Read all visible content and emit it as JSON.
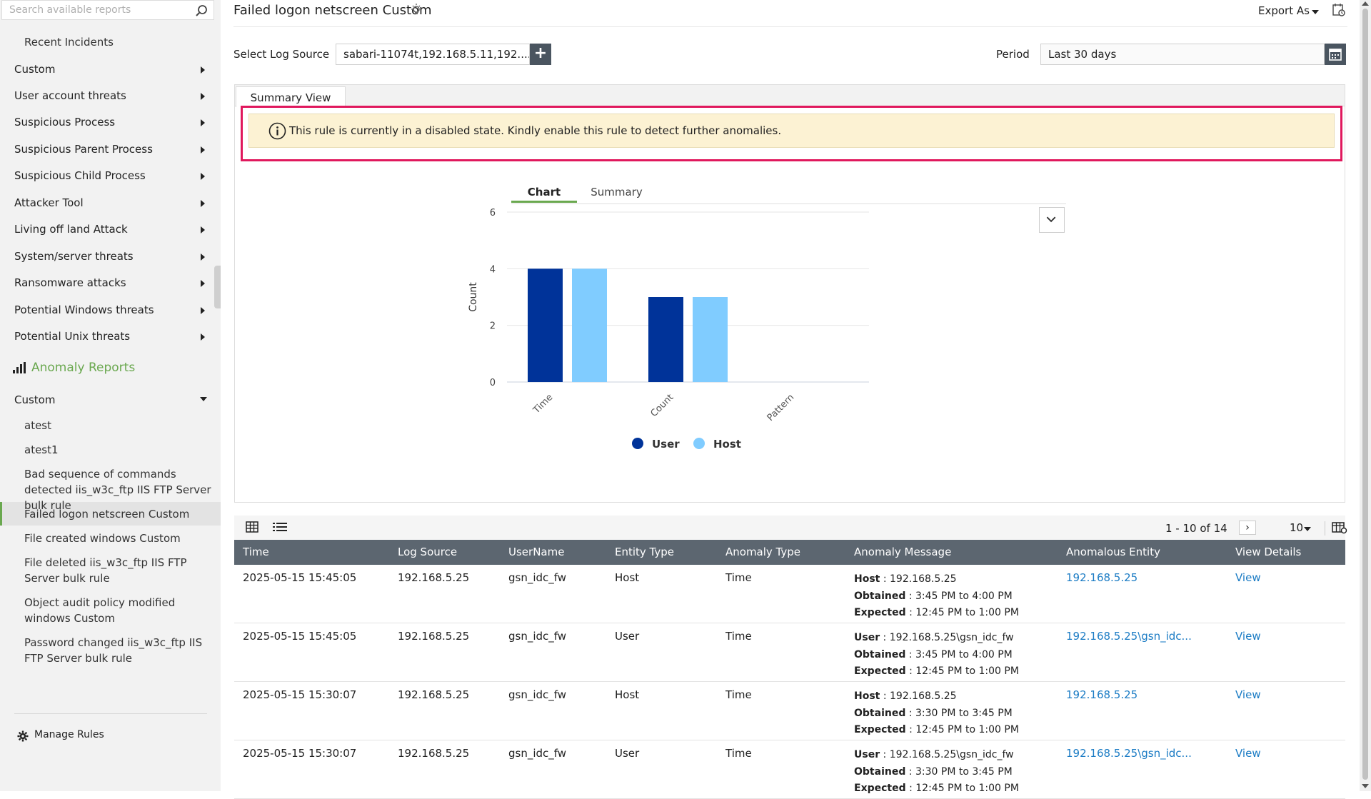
{
  "sidebar": {
    "search_placeholder": "Search available reports",
    "recent": "Recent Incidents",
    "categories": [
      "Custom",
      "User account threats",
      "Suspicious Process",
      "Suspicious Parent Process",
      "Suspicious Child Process",
      "Attacker Tool",
      "Living off land Attack",
      "System/server threats",
      "Ransomware attacks",
      "Potential Windows threats",
      "Potential Unix threats"
    ],
    "anomaly_heading": "Anomaly Reports",
    "anomaly_group": "Custom",
    "anomaly_items": [
      "atest",
      "atest1",
      "Bad sequence of commands detected iis_w3c_ftp IIS FTP Server bulk rule",
      "Failed logon netscreen Custom",
      "File created windows Custom",
      "File deleted iis_w3c_ftp IIS FTP Server bulk rule",
      "Object audit policy modified windows Custom",
      "Password changed iis_w3c_ftp IIS FTP Server bulk rule"
    ],
    "active_item_index": 3,
    "manage_rules": "Manage Rules"
  },
  "header": {
    "title": "Failed logon netscreen Custom",
    "export_label": "Export As"
  },
  "filters": {
    "log_source_label": "Select Log Source",
    "log_source_value": "sabari-11074t,192.168.5.11,192....",
    "period_label": "Period",
    "period_value": "Last 30 days"
  },
  "panel": {
    "tab_label": "Summary View",
    "alert_text": "This rule is currently in a disabled state. Kindly enable this rule to detect further anomalies.",
    "view_tabs": [
      "Chart",
      "Summary"
    ]
  },
  "chart_data": {
    "type": "bar",
    "categories": [
      "Time",
      "Count",
      "Pattern"
    ],
    "series": [
      {
        "name": "User",
        "values": [
          4,
          3,
          0
        ],
        "color": "#003399"
      },
      {
        "name": "Host",
        "values": [
          4,
          3,
          0
        ],
        "color": "#80ccff"
      }
    ],
    "ylabel": "Count",
    "xlabel": "",
    "ylim": [
      0,
      6
    ],
    "yticks": [
      0,
      2,
      4,
      6
    ],
    "grid": true,
    "legend": "bottom"
  },
  "table": {
    "pager_text": "1 - 10 of 14",
    "page_size": "10",
    "columns": [
      "Time",
      "Log Source",
      "UserName",
      "Entity Type",
      "Anomaly Type",
      "Anomaly Message",
      "Anomalous Entity",
      "View Details"
    ],
    "rows": [
      {
        "time": "2025-05-15 15:45:05",
        "source": "192.168.5.25",
        "user": "gsn_idc_fw",
        "entity_type": "Host",
        "anomaly_type": "Time",
        "msg_k1": "Host",
        "msg_v1": "192.168.5.25",
        "msg_k2": "Obtained",
        "msg_v2": "3:45 PM to 4:00 PM",
        "msg_k3": "Expected",
        "msg_v3": "12:45 PM to 1:00 PM",
        "entity": "192.168.5.25",
        "view": "View"
      },
      {
        "time": "2025-05-15 15:45:05",
        "source": "192.168.5.25",
        "user": "gsn_idc_fw",
        "entity_type": "User",
        "anomaly_type": "Time",
        "msg_k1": "User",
        "msg_v1": "192.168.5.25\\gsn_idc_fw",
        "msg_k2": "Obtained",
        "msg_v2": "3:45 PM to 4:00 PM",
        "msg_k3": "Expected",
        "msg_v3": "12:45 PM to 1:00 PM",
        "entity": "192.168.5.25\\gsn_idc...",
        "view": "View"
      },
      {
        "time": "2025-05-15 15:30:07",
        "source": "192.168.5.25",
        "user": "gsn_idc_fw",
        "entity_type": "Host",
        "anomaly_type": "Time",
        "msg_k1": "Host",
        "msg_v1": "192.168.5.25",
        "msg_k2": "Obtained",
        "msg_v2": "3:30 PM to 3:45 PM",
        "msg_k3": "Expected",
        "msg_v3": "12:45 PM to 1:00 PM",
        "entity": "192.168.5.25",
        "view": "View"
      },
      {
        "time": "2025-05-15 15:30:07",
        "source": "192.168.5.25",
        "user": "gsn_idc_fw",
        "entity_type": "User",
        "anomaly_type": "Time",
        "msg_k1": "User",
        "msg_v1": "192.168.5.25\\gsn_idc_fw",
        "msg_k2": "Obtained",
        "msg_v2": "3:30 PM to 3:45 PM",
        "msg_k3": "Expected",
        "msg_v3": "12:45 PM to 1:00 PM",
        "entity": "192.168.5.25\\gsn_idc...",
        "view": "View"
      }
    ]
  },
  "colors": {
    "accent": "#6aa84f",
    "alert_border": "#e0185d",
    "alert_bg": "#fcf2d3",
    "table_header": "#5c6670",
    "link": "#1a7bc4"
  }
}
